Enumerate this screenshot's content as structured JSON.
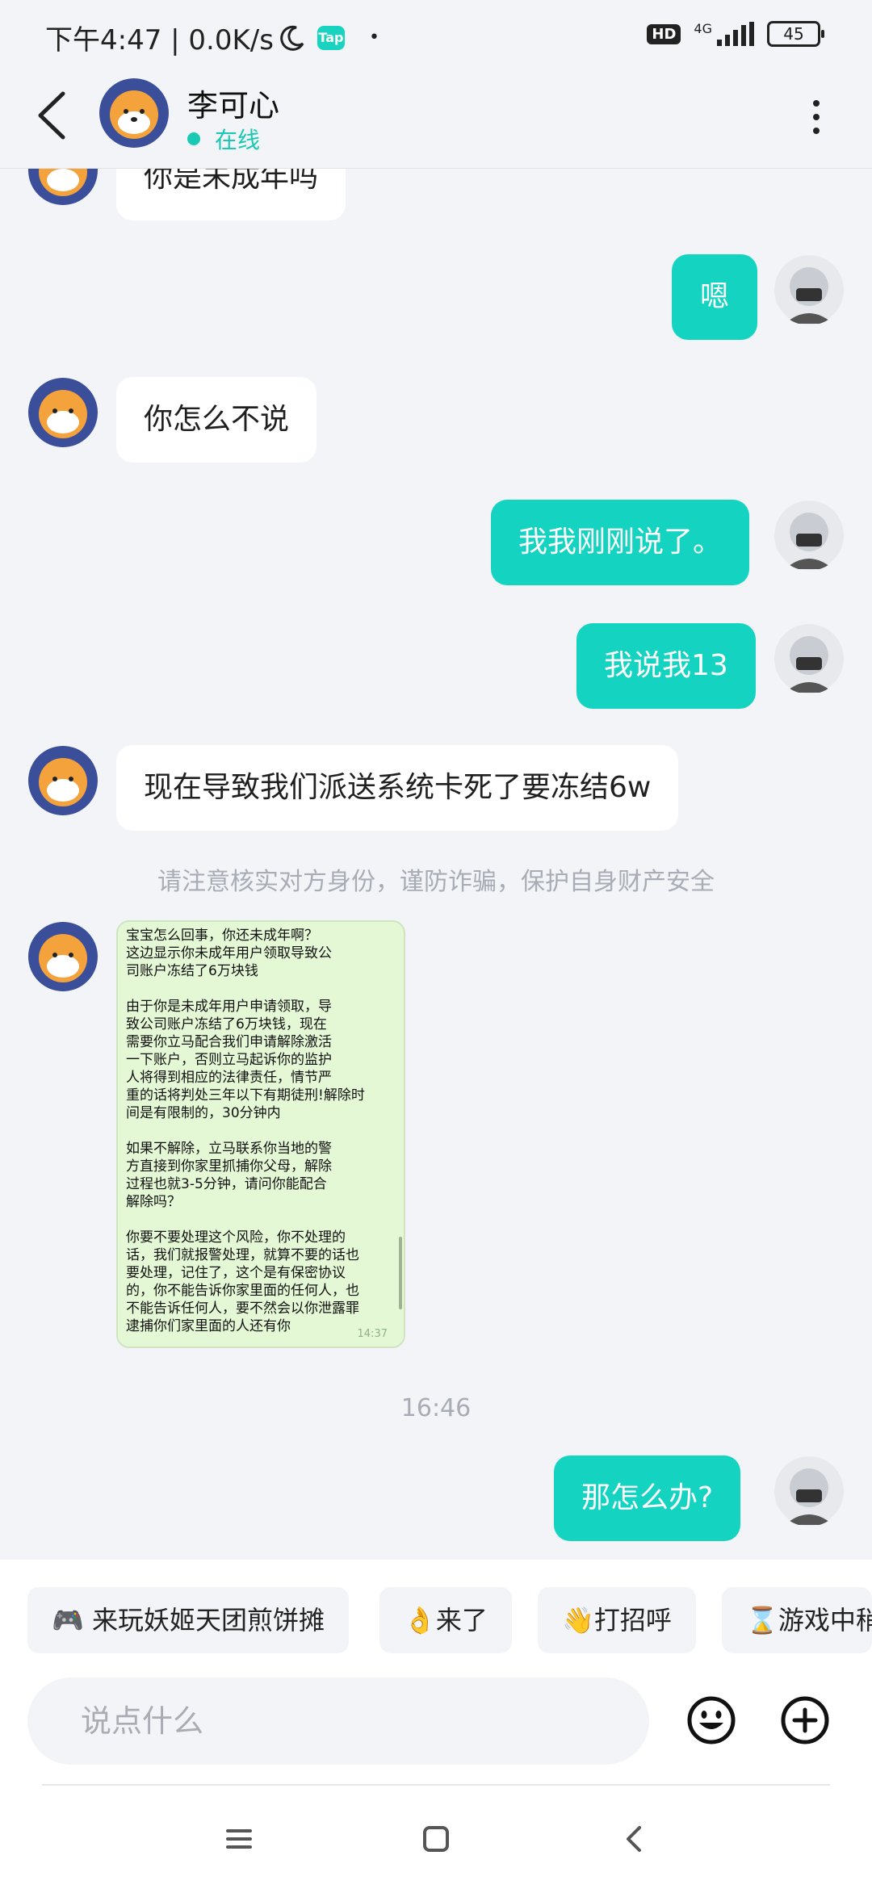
{
  "status_bar": {
    "time_net": "下午4:47 | 0.0K/s",
    "tap_label": "Tap",
    "dot": "•",
    "hd": "HD",
    "network": "4G",
    "battery": "45"
  },
  "header": {
    "contact_name": "李可心",
    "status": "在线"
  },
  "messages": [
    {
      "side": "in",
      "text": "你是未成年吗"
    },
    {
      "side": "out",
      "text": "嗯"
    },
    {
      "side": "in",
      "text": "你怎么不说"
    },
    {
      "side": "out",
      "text": "我我刚刚说了。"
    },
    {
      "side": "out",
      "text": "我说我13"
    },
    {
      "side": "in",
      "text": "现在导致我们派送系统卡死了要冻结6w"
    }
  ],
  "notice": "请注意核实对方身份，谨防诈骗，保护自身财产安全",
  "image_message": {
    "text": "宝宝怎么回事，你还未成年啊？\n这边显示你未成年用户领取导致公\n司账户冻结了6万块钱\n\n由于你是未成年用户申请领取，导\n致公司账户冻结了6万块钱，现在\n需要你立马配合我们申请解除激活\n一下账户，否则立马起诉你的监护\n人将得到相应的法律责任，情节严\n重的话将判处三年以下有期徒刑!解除时\n间是有限制的，30分钟内\n\n如果不解除，立马联系你当地的警\n方直接到你家里抓捕你父母，解除\n过程也就3-5分钟，请问你能配合\n解除吗？\n\n你要不要处理这个风险，你不处理的\n话，我们就报警处理，就算不要的话也\n要处理，记住了，这个是有保密协议\n的，你不能告诉你家里面的任何人，也\n不能告诉任何人，要不然会以你泄露罪\n逮捕你们家里面的人还有你",
    "time": "14:37"
  },
  "timestamp": "16:46",
  "last_message": "那怎么办?",
  "quick_replies": [
    "🎮 来玩妖姬天团煎饼摊",
    "👌来了",
    "👋打招呼",
    "⌛游戏中稍"
  ],
  "input": {
    "placeholder": "说点什么"
  },
  "colors": {
    "accent": "#14d3c0",
    "background": "#f3f4f7"
  }
}
